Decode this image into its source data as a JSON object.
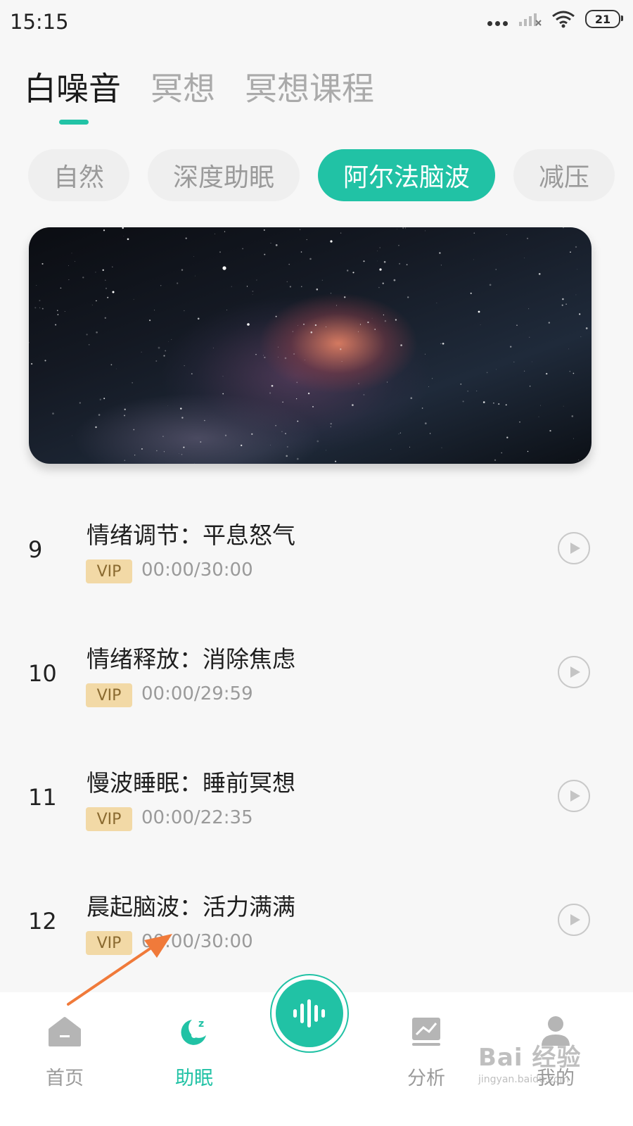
{
  "status_bar": {
    "time": "15:15",
    "battery": "21"
  },
  "top_tabs": [
    {
      "label": "白噪音",
      "active": true
    },
    {
      "label": "冥想",
      "active": false
    },
    {
      "label": "冥想课程",
      "active": false
    }
  ],
  "categories": [
    {
      "label": "自然",
      "active": false
    },
    {
      "label": "深度助眠",
      "active": false
    },
    {
      "label": "阿尔法脑波",
      "active": true
    },
    {
      "label": "减压",
      "active": false
    }
  ],
  "tracks": [
    {
      "index": "9",
      "title": "情绪调节：平息怒气",
      "badge": "VIP",
      "duration": "00:00/30:00"
    },
    {
      "index": "10",
      "title": "情绪释放：消除焦虑",
      "badge": "VIP",
      "duration": "00:00/29:59"
    },
    {
      "index": "11",
      "title": "慢波睡眠：睡前冥想",
      "badge": "VIP",
      "duration": "00:00/22:35"
    },
    {
      "index": "12",
      "title": "晨起脑波：活力满满",
      "badge": "VIP",
      "duration": "00:00/30:00"
    }
  ],
  "bottom_nav": [
    {
      "label": "首页",
      "icon": "home-icon",
      "active": false
    },
    {
      "label": "助眠",
      "icon": "moon-sleep-icon",
      "active": true
    },
    {
      "label": "",
      "icon": "soundwave-icon",
      "active": false
    },
    {
      "label": "分析",
      "icon": "chart-icon",
      "active": false
    },
    {
      "label": "我的",
      "icon": "profile-icon",
      "active": false
    }
  ],
  "watermark": {
    "main": "Bai 经验",
    "sub": "jingyan.baidu.com"
  },
  "colors": {
    "accent": "#21c2a5",
    "vip_bg": "#f2d9a6",
    "annotation_arrow": "#f07a3a"
  }
}
